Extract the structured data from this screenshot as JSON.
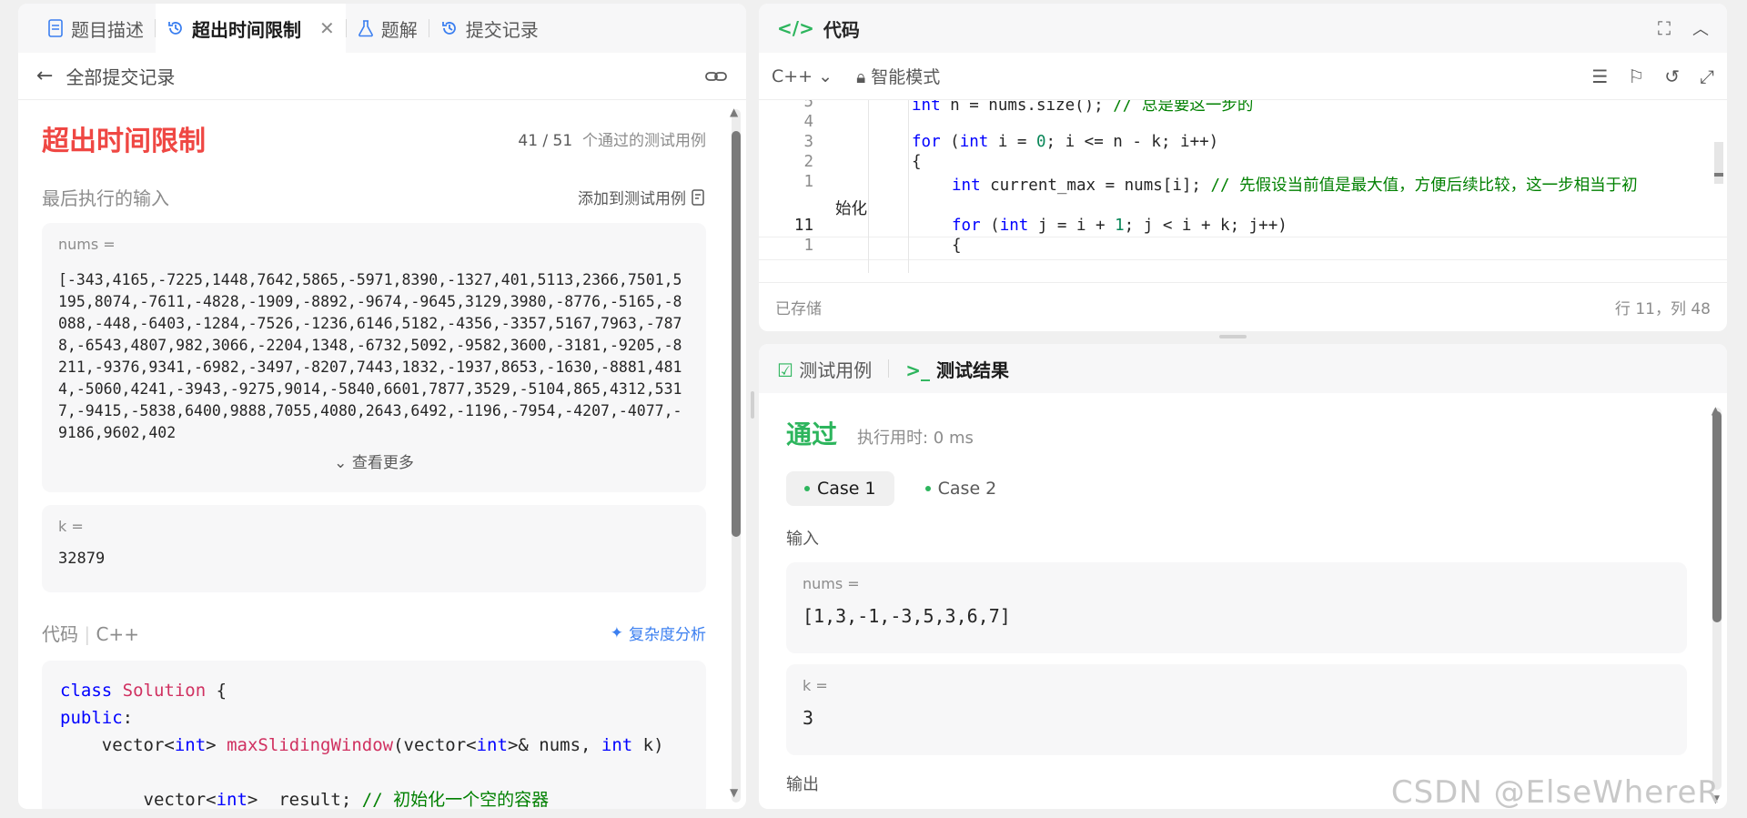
{
  "left": {
    "tabs": [
      {
        "label": "题目描述",
        "icon": "doc-icon"
      },
      {
        "label": "超出时间限制",
        "icon": "history-icon",
        "active": true,
        "closable": true
      },
      {
        "label": "题解",
        "icon": "flask-icon"
      },
      {
        "label": "提交记录",
        "icon": "history-icon"
      }
    ],
    "back_label": "全部提交记录",
    "status": "超出时间限制",
    "passed": "41 / 51",
    "passed_suffix": "个通过的测试用例",
    "last_input_label": "最后执行的输入",
    "add_testcase_label": "添加到测试用例",
    "nums_label": "nums =",
    "nums_value": "[-343,4165,-7225,1448,7642,5865,-5971,8390,-1327,401,5113,2366,7501,5195,8074,-7611,-4828,-1909,-8892,-9674,-9645,3129,3980,-8776,-5165,-8088,-448,-6403,-1284,-7526,-1236,6146,5182,-4356,-3357,5167,7963,-7878,-6543,4807,982,3066,-2204,1348,-6732,5092,-9582,3600,-3181,-9205,-8211,-9376,9341,-6982,-3497,-8207,7443,1832,-1937,8653,-1630,-8881,4814,-5060,4241,-3943,-9275,9014,-5840,6601,7877,3529,-5104,865,4312,5317,-9415,-5838,6400,9888,7055,4080,2643,6492,-1196,-7954,-4207,-4077,-9186,9602,402",
    "see_more": "查看更多",
    "k_label": "k =",
    "k_value": "32879",
    "code_label": "代码",
    "code_lang": "C++",
    "complexity_label": "复杂度分析"
  },
  "editor": {
    "title": "代码",
    "language": "C++",
    "mode": "智能模式",
    "saved": "已存储",
    "cursor": "行 11，列 48",
    "lines": [
      {
        "n": "5",
        "text": "int n = nums.size(); // 总是要这一步的"
      },
      {
        "n": "4",
        "text": ""
      },
      {
        "n": "3",
        "text": "for (int i = 0; i <= n - k; i++)"
      },
      {
        "n": "2",
        "text": "{"
      },
      {
        "n": "1",
        "text": "int current_max = nums[i]; // 先假设当前值是最大值，方便后续比较，这一步相当于初"
      },
      {
        "n": "",
        "text": "始化"
      },
      {
        "n": "11",
        "text": "for (int j = i + 1; j < i + k; j++)"
      },
      {
        "n": "1",
        "text": "{"
      }
    ]
  },
  "result": {
    "tab_testcase": "测试用例",
    "tab_result": "测试结果",
    "status": "通过",
    "runtime": "执行用时: 0 ms",
    "cases": [
      "Case 1",
      "Case 2"
    ],
    "input_label": "输入",
    "nums_label": "nums =",
    "nums_value": "[1,3,-1,-3,5,3,6,7]",
    "k_label": "k =",
    "k_value": "3",
    "output_label": "输出"
  },
  "watermark": "CSDN @ElseWhereR",
  "colors": {
    "error": "#ef4743",
    "pass": "#2db55d",
    "link": "#3b7ff0"
  }
}
